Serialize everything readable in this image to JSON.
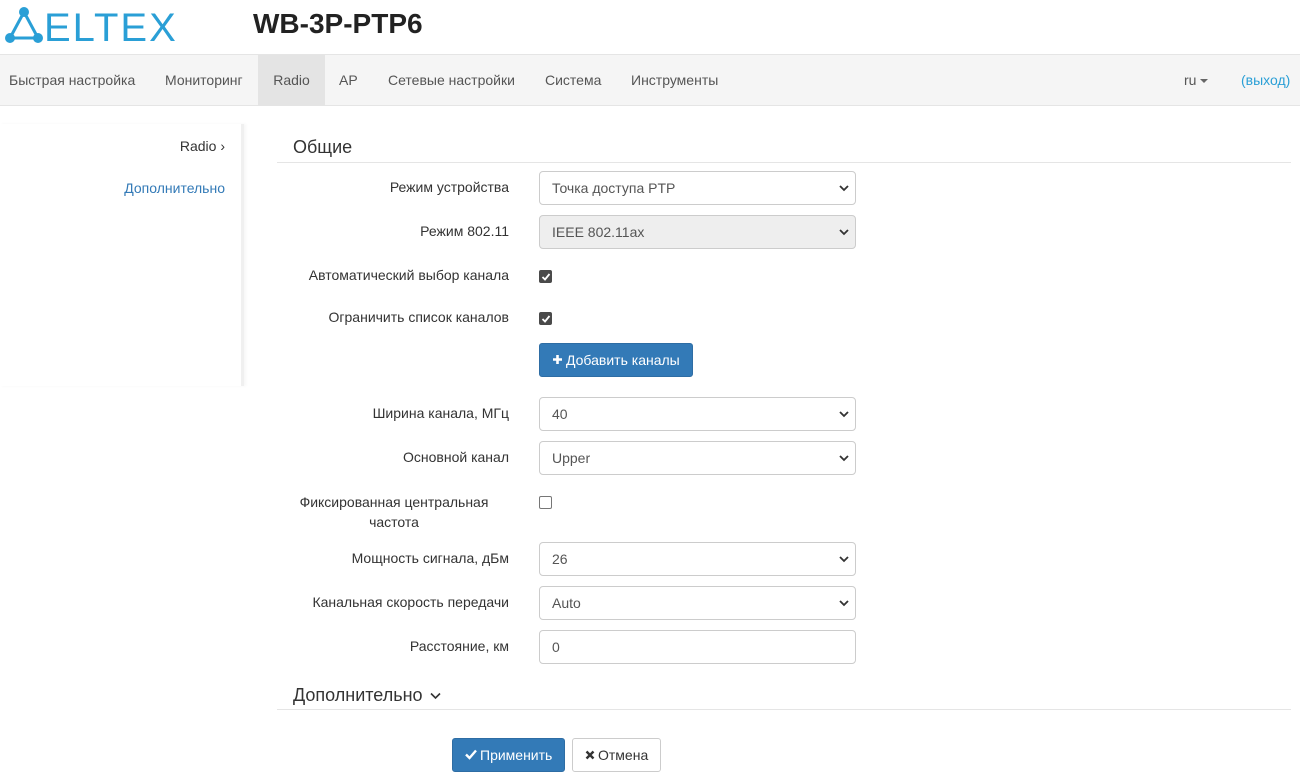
{
  "header": {
    "logo_text": "ELTEX",
    "device_model": "WB-3P-PTP6"
  },
  "nav": {
    "items": [
      {
        "label": "Быстрая настройка"
      },
      {
        "label": "Мониторинг"
      },
      {
        "label": "Radio",
        "active": true
      },
      {
        "label": "AP"
      },
      {
        "label": "Сетевые настройки"
      },
      {
        "label": "Система"
      },
      {
        "label": "Инструменты"
      }
    ],
    "language": "ru",
    "logout": "(выход)"
  },
  "sidebar": {
    "items": [
      {
        "label": "Radio ›"
      },
      {
        "label": "Дополнительно"
      }
    ]
  },
  "general": {
    "title": "Общие",
    "device_mode": {
      "label": "Режим устройства",
      "value": "Точка доступа PTP"
    },
    "mode_80211": {
      "label": "Режим 802.11",
      "value": "IEEE 802.11ax"
    },
    "auto_channel": {
      "label": "Автоматический выбор канала",
      "checked": true
    },
    "limit_channels": {
      "label": "Ограничить список каналов",
      "checked": true
    },
    "add_channels_button": "Добавить каналы",
    "channel_width": {
      "label": "Ширина канала, МГц",
      "value": "40"
    },
    "primary_channel": {
      "label": "Основной канал",
      "value": "Upper"
    },
    "fixed_center_freq": {
      "label": "Фиксированная центральная частота",
      "checked": false
    },
    "tx_power": {
      "label": "Мощность сигнала, дБм",
      "value": "26"
    },
    "tx_rate": {
      "label": "Канальная скорость передачи",
      "value": "Auto"
    },
    "distance": {
      "label": "Расстояние, км",
      "value": "0"
    }
  },
  "advanced": {
    "title": "Дополнительно"
  },
  "actions": {
    "apply": "Применить",
    "cancel": "Отмена"
  },
  "colors": {
    "brand": "#2a9fd6",
    "primary": "#337ab7",
    "nav_bg": "#f5f5f5"
  }
}
